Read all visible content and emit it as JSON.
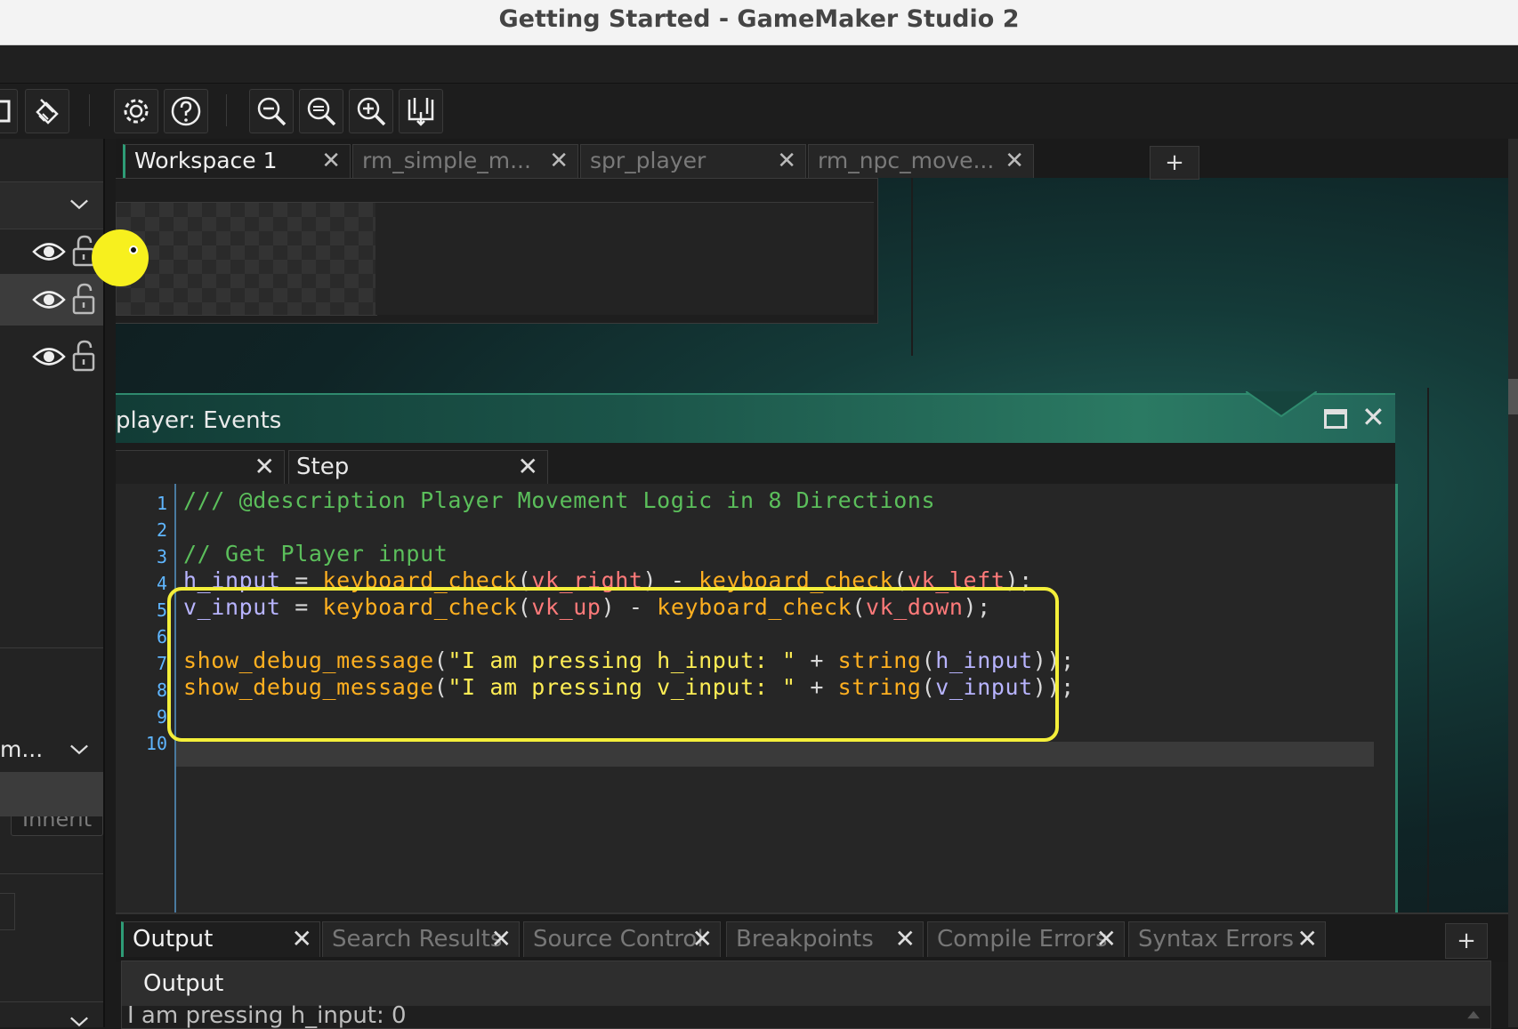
{
  "window": {
    "title": "Getting Started - GameMaker Studio 2"
  },
  "toolbar": {
    "buttons": [
      "clean-icon",
      "settings-icon",
      "help-icon",
      "zoom-out-icon",
      "zoom-reset-icon",
      "zoom-in-icon",
      "fit-icon"
    ]
  },
  "workspace_tabs": [
    {
      "label": "Workspace 1",
      "active": true
    },
    {
      "label": "rm_simple_m...",
      "active": false
    },
    {
      "label": "spr_player",
      "active": false
    },
    {
      "label": "rm_npc_move...",
      "active": false
    }
  ],
  "workspace_add": "+",
  "left_panel": {
    "inherit_label": "Inherit",
    "dropdown_label": "m..."
  },
  "events_window": {
    "title": "player: Events",
    "tabs": [
      {
        "label": ""
      },
      {
        "label": "Step"
      }
    ]
  },
  "code": {
    "line_numbers": [
      "1",
      "2",
      "3",
      "4",
      "5",
      "6",
      "7",
      "8",
      "9",
      "10"
    ],
    "lines": [
      "/// @description Player Movement Logic in 8 Directions",
      "",
      "// Get Player input",
      "h_input = keyboard_check(vk_right) - keyboard_check(vk_left);",
      "v_input = keyboard_check(vk_up) - keyboard_check(vk_down);",
      "",
      "show_debug_message(\"I am pressing h_input: \" + string(h_input));",
      "show_debug_message(\"I am pressing v_input: \" + string(v_input));",
      "",
      ""
    ]
  },
  "output_tabs": [
    {
      "label": "Output",
      "active": true
    },
    {
      "label": "Search Results",
      "active": false
    },
    {
      "label": "Source Control",
      "active": false
    },
    {
      "label": "Breakpoints",
      "active": false
    },
    {
      "label": "Compile Errors",
      "active": false
    },
    {
      "label": "Syntax Errors",
      "active": false
    }
  ],
  "output_add": "+",
  "output_panel": {
    "header": "Output",
    "last_line": "I am pressing h_input: 0"
  },
  "colors": {
    "highlight_box": "#f4ef3a",
    "accent": "#2e9c76",
    "comment": "#5bbf5b",
    "function": "#ffb020",
    "constant": "#ff7a7a",
    "string": "#ffee55",
    "variable": "#b8b4ff"
  }
}
